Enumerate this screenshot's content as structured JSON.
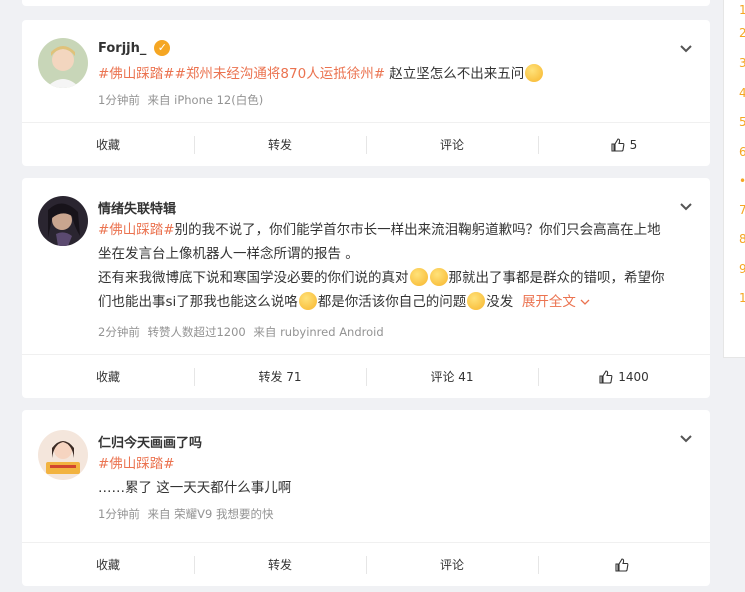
{
  "posts": [
    {
      "username": "Forjjh_",
      "verified": true,
      "topics": [
        "#佛山踩踏#",
        "#郑州未经沟通将870人运抵徐州#"
      ],
      "text": " 赵立坚怎么不出来五问",
      "time": "1分钟前",
      "source": "来自 iPhone 12(白色)",
      "actions": {
        "collect": "收藏",
        "repost": "转发",
        "comment": "评论",
        "like": "5"
      }
    },
    {
      "username": "情绪失联特辑",
      "verified": false,
      "topics": [
        "#佛山踩踏#"
      ],
      "text_line1": "别的我不说了，你们能学首尔市长一样出来流泪鞠躬道歉吗？你们只会高高在上地",
      "text_line2": "坐在发言台上像机器人一样念所谓的报告 。",
      "text_line3": "还有来我微博底下说和寒国学没必要的你们说的真对",
      "text_line3b": "那就出了事都是群众的错呗，希望你",
      "text_line4": "们也能出事si了那我也能这么说咯",
      "text_line4b": "都是你活该你自己的问题",
      "text_line4c": "没发",
      "expand": "展开全文",
      "time": "2分钟前",
      "repost_info": "转赞人数超过1200",
      "source": "来自 rubyinred Android",
      "actions": {
        "collect": "收藏",
        "repost": "转发 71",
        "comment": "评论 41",
        "like": "1400"
      }
    },
    {
      "username": "仁归今天画画了吗",
      "verified": false,
      "topics": [
        "#佛山踩踏#"
      ],
      "text": "……累了 这一天天都什么事儿啊",
      "time": "1分钟前",
      "source": "来自 荣耀V9 我想要的快",
      "actions": {
        "collect": "收藏",
        "repost": "转发",
        "comment": "评论",
        "like": ""
      }
    }
  ],
  "sidebar_numbers": [
    "1",
    "2",
    "3",
    "4",
    "5",
    "6",
    "•",
    "7",
    "8",
    "9",
    "1"
  ],
  "colors": {
    "topic": "#eb7350",
    "badge": "#f5a623",
    "bg": "#f0f1f4"
  }
}
